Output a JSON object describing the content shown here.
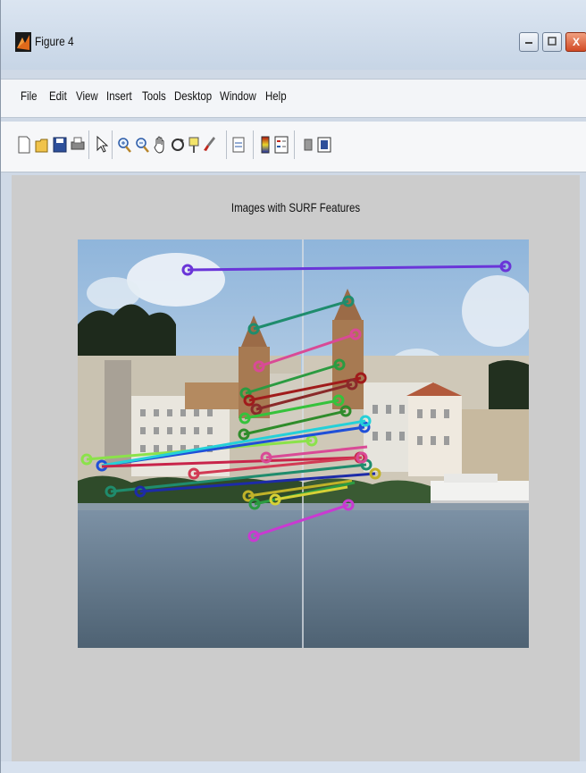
{
  "window": {
    "title": "Figure 4",
    "minimize_label": "▫",
    "maximize_label": "▣",
    "close_label": "X"
  },
  "menu": {
    "items": [
      "File",
      "Edit",
      "View",
      "Insert",
      "Tools",
      "Desktop",
      "Window",
      "Help"
    ]
  },
  "toolbar": {
    "icons": [
      "new-figure-icon",
      "open-icon",
      "save-icon",
      "print-icon",
      "pointer-icon",
      "zoom-in-icon",
      "zoom-out-icon",
      "pan-icon",
      "rotate-3d-icon",
      "data-cursor-icon",
      "brush-icon",
      "link-plot-icon",
      "colorbar-icon",
      "legend-icon",
      "hide-plot-tools-icon",
      "show-plot-tools-icon"
    ]
  },
  "figure": {
    "title": "Images with SURF Features"
  },
  "colors": {
    "sky": "#a9c6e2",
    "water": "#6f8598",
    "figure_bg": "#cccccc",
    "titlebar": "#d2deec"
  }
}
